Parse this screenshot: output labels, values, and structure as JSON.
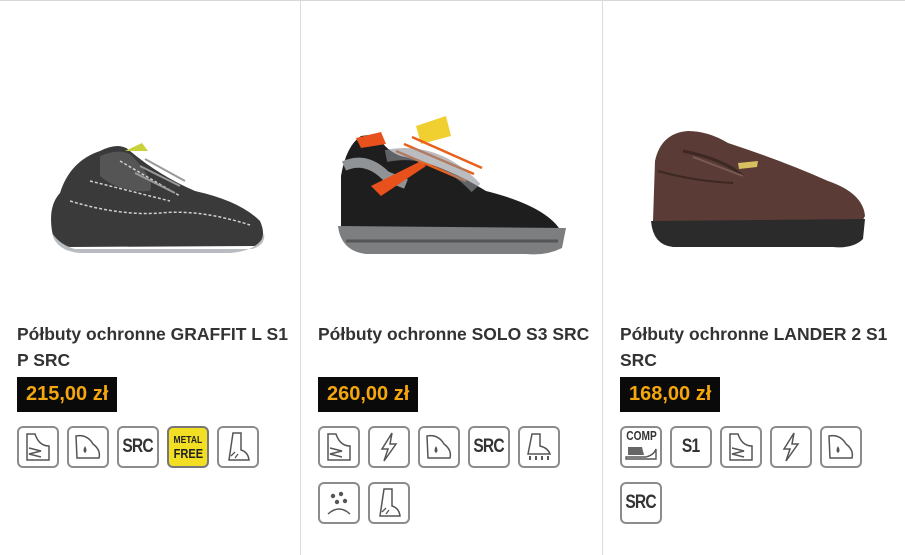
{
  "products": [
    {
      "name": "Półbuty ochronne GRAFFIT L S1 P SRC",
      "price": "215,00 zł",
      "badges": [
        "sole-anti-perforation-icon",
        "heel-energy-absorption-icon",
        "SRC",
        "METAL FREE",
        "boot-antistatic-icon"
      ]
    },
    {
      "name": "Półbuty ochronne SOLO S3 SRC",
      "price": "260,00 zł",
      "badges": [
        "sole-anti-perforation-icon",
        "antistatic-lightning-icon",
        "heel-energy-absorption-icon",
        "SRC",
        "cleated-sole-icon",
        "water-resistant-icon",
        "boot-antistatic-icon"
      ]
    },
    {
      "name": "Półbuty ochronne LANDER 2 S1 SRC",
      "price": "168,00 zł",
      "badges": [
        "COMP",
        "S1",
        "sole-anti-perforation-icon",
        "antistatic-lightning-icon",
        "heel-energy-absorption-icon",
        "SRC"
      ]
    }
  ],
  "badge_text": {
    "src": "SRC",
    "s1": "S1",
    "comp": "COMP",
    "metal_free_1": "METAL",
    "metal_free_2": "FREE"
  },
  "colors": {
    "price_bg": "#0a0a0a",
    "price_text": "#f4a60c",
    "metal_free_bg": "#f2df24"
  }
}
